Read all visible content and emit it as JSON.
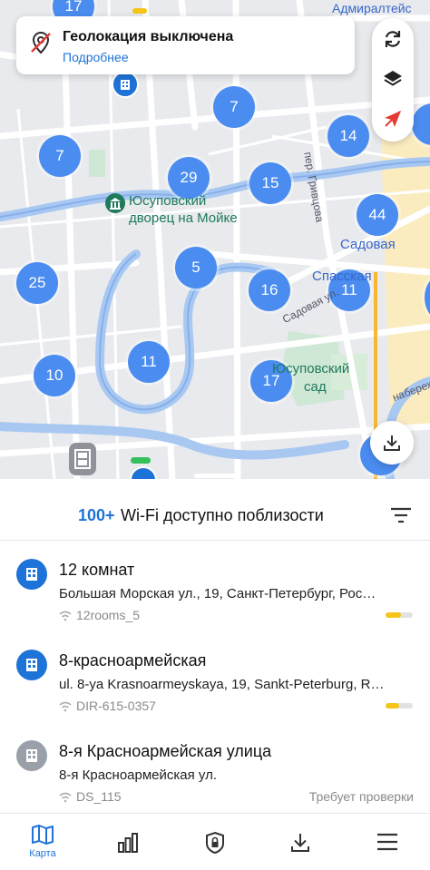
{
  "geo_card": {
    "title": "Геолокация выключена",
    "link": "Подробнее"
  },
  "map": {
    "clusters": [
      "17",
      "7",
      "14",
      "7",
      "29",
      "15",
      "44",
      "25",
      "5",
      "16",
      "11",
      "10",
      "11",
      "17"
    ],
    "labels": {
      "palace_line1": "Юсуповский",
      "palace_line2": "дворец на Мойке",
      "garden_line1": "Юсуповский",
      "garden_line2": "сад",
      "sadovaya": "Садовая",
      "spasskaya": "Спасская",
      "sadovaya_street": "Садовая ул.",
      "griboyedov_street": "пер. Гривцова",
      "admiralteyskaya": "Адмиралтейс",
      "naberezhnaya": "набереж"
    }
  },
  "sheet": {
    "count": "100+",
    "title": "Wi-Fi доступно поблизости"
  },
  "networks": [
    {
      "name": "12 комнат",
      "address": "Большая Морская ул., 19, Санкт-Петербург, Рос…",
      "ssid": "12rooms_5",
      "status": "",
      "signal": 0.55,
      "verified": true
    },
    {
      "name": "8-красноармейская",
      "address": "ul. 8-ya Krasnoarmeyskaya, 19, Sankt-Peterburg, R…",
      "ssid": "DIR-615-0357",
      "status": "",
      "signal": 0.5,
      "verified": true
    },
    {
      "name": "8-я Красноармейская улица",
      "address": "8-я Красноармейская ул.",
      "ssid": "DS_115",
      "status": "Требует проверки",
      "signal": null,
      "verified": false
    }
  ],
  "bottom_nav": {
    "map_label": "Карта"
  },
  "colors": {
    "accent": "#1e73d8",
    "cluster": "#4a8cf0",
    "signal": "#f5c518",
    "pin_unverified": "#9aa0a8"
  }
}
